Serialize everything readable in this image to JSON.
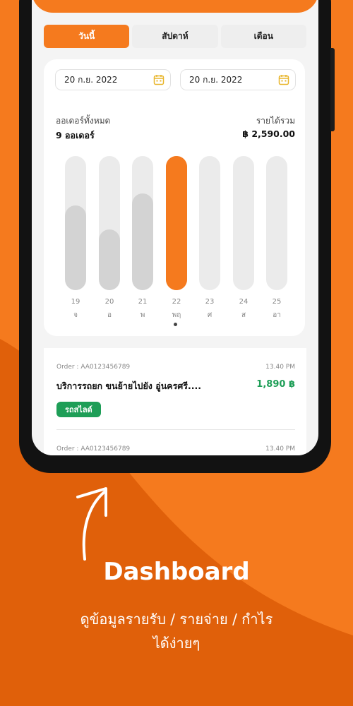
{
  "colors": {
    "brand": "#F57A1E",
    "brand_dark": "#E0600A",
    "success": "#1E9E57",
    "bar_inactive": "#D3D3D3",
    "track": "#EBEBEB"
  },
  "tabs": [
    {
      "label": "วันนี้",
      "active": true
    },
    {
      "label": "สัปดาห์",
      "active": false
    },
    {
      "label": "เดือน",
      "active": false
    }
  ],
  "date_range": {
    "start": "20 ก.ย. 2022",
    "end": "20 ก.ย. 2022",
    "icon": "calendar-icon"
  },
  "summary": {
    "orders_label": "ออเดอร์ทั้งหมด",
    "orders_value": "9 ออเดอร์",
    "revenue_label": "รายได้รวม",
    "revenue_value": "฿ 2,590.00"
  },
  "chart_data": {
    "type": "bar",
    "categories": [
      "19 จ",
      "20 อ",
      "21 พ",
      "22 พฤ",
      "23 ศ",
      "24 ส",
      "25 อา"
    ],
    "days": [
      "19",
      "20",
      "21",
      "22",
      "23",
      "24",
      "25"
    ],
    "weekdays": [
      "จ",
      "อ",
      "พ",
      "พฤ",
      "ศ",
      "ส",
      "อา"
    ],
    "values": [
      0.63,
      0.45,
      0.72,
      1.0,
      0,
      0,
      0
    ],
    "selected_index": 3,
    "ylim": [
      0,
      1
    ]
  },
  "orders": [
    {
      "order_no": "Order : AA0123456789",
      "time": "13.40 PM",
      "title": "บริการรถยก ขนย้ายไปยัง อู่นครศรี....",
      "price": "1,890 ฿",
      "badge": "รถสไลด์"
    },
    {
      "order_no": "Order : AA0123456789",
      "time": "13.40 PM"
    }
  ],
  "promo": {
    "headline": "Dashboard",
    "subtitle_line1": "ดูข้อมูลรายรับ / รายจ่าย / กำไร",
    "subtitle_line2": "ได้ง่ายๆ"
  }
}
